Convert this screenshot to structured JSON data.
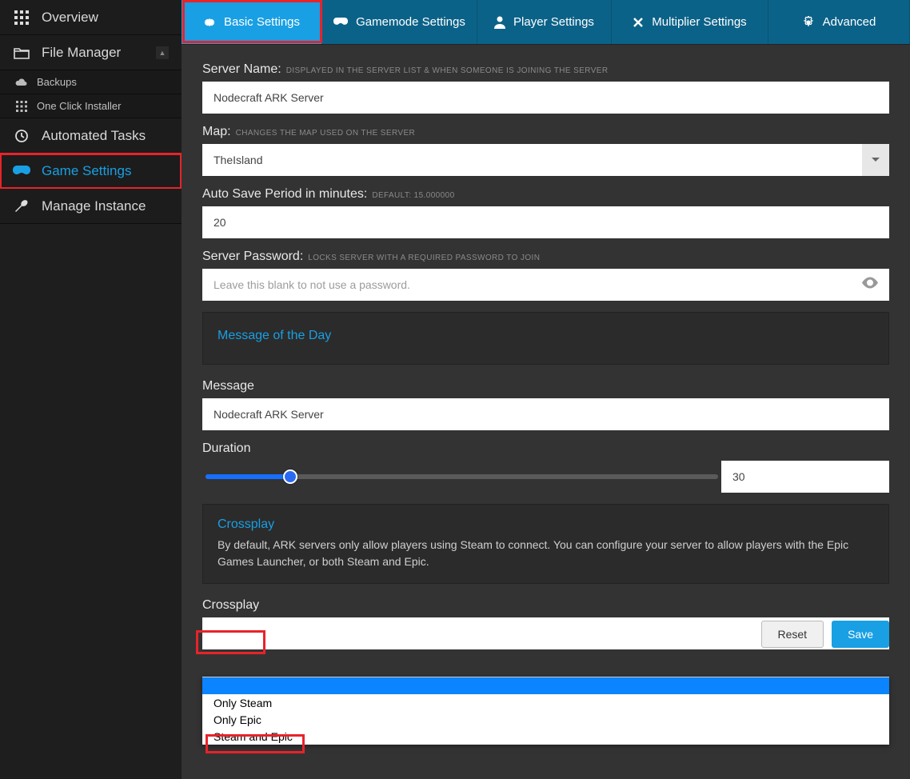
{
  "sidebar": {
    "overview": "Overview",
    "file_manager": "File Manager",
    "backups": "Backups",
    "one_click": "One Click Installer",
    "automated_tasks": "Automated Tasks",
    "game_settings": "Game Settings",
    "manage_instance": "Manage Instance"
  },
  "tabs": {
    "basic": "Basic Settings",
    "gamemode": "Gamemode Settings",
    "player": "Player Settings",
    "multiplier": "Multiplier Settings",
    "advanced": "Advanced"
  },
  "form": {
    "server_name_label": "Server Name:",
    "server_name_hint": "DISPLAYED IN THE SERVER LIST & WHEN SOMEONE IS JOINING THE SERVER",
    "server_name_value": "Nodecraft ARK Server",
    "map_label": "Map:",
    "map_hint": "CHANGES THE MAP USED ON THE SERVER",
    "map_value": "TheIsland",
    "autosave_label": "Auto Save Period in minutes:",
    "autosave_hint": "DEFAULT: 15.000000",
    "autosave_value": "20",
    "password_label": "Server Password:",
    "password_hint": "LOCKS SERVER WITH A REQUIRED PASSWORD TO JOIN",
    "password_placeholder": "Leave this blank to not use a password.",
    "motd_panel_title": "Message of the Day",
    "message_label": "Message",
    "message_value": "Nodecraft ARK Server",
    "duration_label": "Duration",
    "duration_value": "30",
    "crossplay_title": "Crossplay",
    "crossplay_desc": "By default, ARK servers only allow players using Steam to connect. You can configure your server to allow players with the Epic Games Launcher, or both Steam and Epic.",
    "crossplay_label": "Crossplay",
    "crossplay_options": {
      "blank": "",
      "only_steam": "Only Steam",
      "only_epic": "Only Epic",
      "steam_and_epic": "Steam and Epic"
    }
  },
  "buttons": {
    "reset": "Reset",
    "save": "Save"
  },
  "slider": {
    "percent": 17
  }
}
